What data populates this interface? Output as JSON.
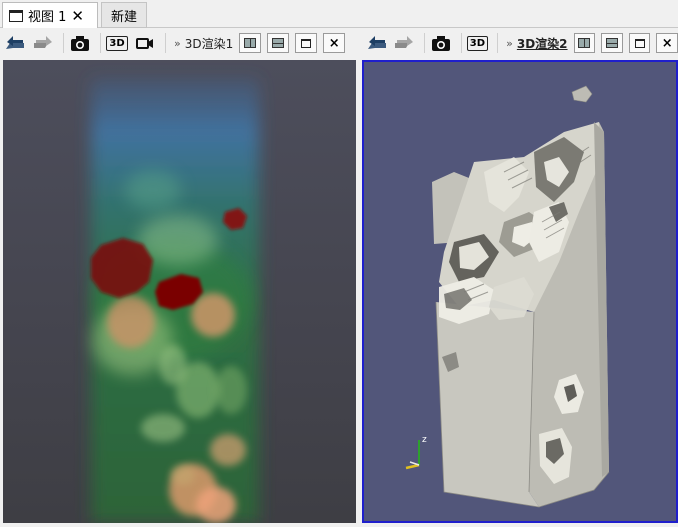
{
  "tabs": [
    {
      "label": "视图 1",
      "close": "✕"
    },
    {
      "label": "新建"
    }
  ],
  "left_toolbar": {
    "view_label": "3D渲染1",
    "chevron": "»",
    "camera_label": "3D",
    "close": "×"
  },
  "right_toolbar": {
    "view_label": "3D渲染2",
    "chevron": "»",
    "camera_label": "3D",
    "close": "×"
  },
  "axes": {
    "z": "z"
  },
  "colors": {
    "active_view_border": "#1f1fcc",
    "right_background": "#52567a",
    "left_background": "#45454f",
    "surface": "#c9c8c0"
  }
}
